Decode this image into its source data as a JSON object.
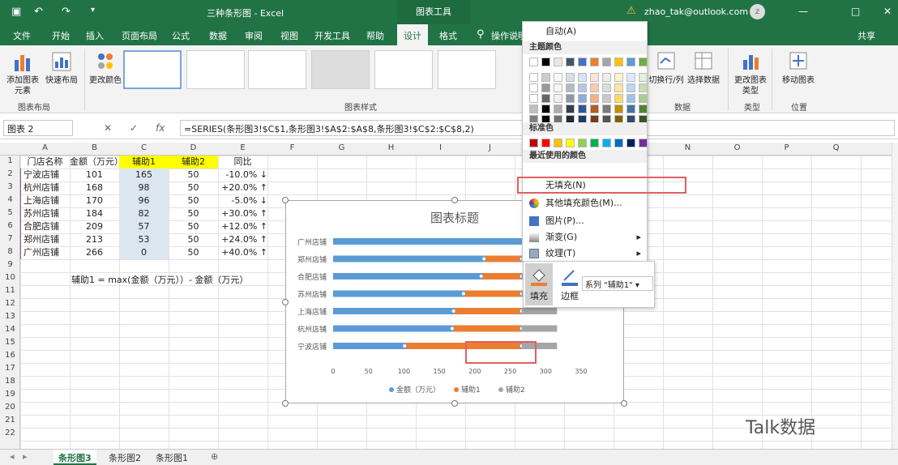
{
  "window": {
    "doc_title": "三种条形图 - Excel",
    "context_tab": "图表工具",
    "user": "zhao_tak@outlook.com",
    "avatar_letter": "z",
    "controls": [
      "—",
      "□",
      "✕"
    ]
  },
  "ribbon_tabs": [
    "文件",
    "开始",
    "插入",
    "页面布局",
    "公式",
    "数据",
    "审阅",
    "视图",
    "开发工具",
    "帮助",
    "设计",
    "格式"
  ],
  "active_tab": "设计",
  "tell_me": "操作说明搜索",
  "share": "共享",
  "ribbon": {
    "add_element": "添加图表元素",
    "quick_layout": "快速布局",
    "change_colors": "更改颜色",
    "group_layouts": "图表布局",
    "group_styles": "图表样式",
    "switch_row_col": "切换行/列",
    "select_data": "选择数据",
    "group_data": "数据",
    "change_type": "更改图表类型",
    "group_type": "类型",
    "move_chart": "移动图表",
    "group_location": "位置"
  },
  "formula_bar": {
    "name_box": "图表 2",
    "formula": "=SERIES(条形图3!$C$1,条形图3!$A$2:$A$8,条形图3!$C$2:$C$8,2)"
  },
  "columns": [
    "A",
    "B",
    "C",
    "D",
    "E",
    "F",
    "G",
    "H",
    "I",
    "J",
    "K",
    "L",
    "M",
    "N",
    "O",
    "P",
    "Q"
  ],
  "rows": [
    "1",
    "2",
    "3",
    "4",
    "5",
    "6",
    "7",
    "8",
    "9",
    "10",
    "11",
    "12",
    "13",
    "14",
    "15",
    "16",
    "17",
    "18",
    "19",
    "20",
    "21",
    "22"
  ],
  "table": {
    "headers": [
      "门店名称",
      "金额（万元）",
      "辅助1",
      "辅助2",
      "同比"
    ],
    "rows": [
      [
        "宁波店铺",
        "101",
        "165",
        "50",
        "-10.0% ↓"
      ],
      [
        "杭州店铺",
        "168",
        "98",
        "50",
        "+20.0% ↑"
      ],
      [
        "上海店铺",
        "170",
        "96",
        "50",
        "-5.0% ↓"
      ],
      [
        "苏州店铺",
        "184",
        "82",
        "50",
        "+30.0% ↑"
      ],
      [
        "合肥店铺",
        "209",
        "57",
        "50",
        "+12.0% ↑"
      ],
      [
        "郑州店铺",
        "213",
        "53",
        "50",
        "+24.0% ↑"
      ],
      [
        "广州店铺",
        "266",
        "0",
        "50",
        "+40.0% ↑"
      ]
    ],
    "note": "辅助1 = max(金额（万元））- 金额（万元）"
  },
  "sheet_tabs": [
    "条形图3",
    "条形图2",
    "条形图1"
  ],
  "active_sheet": "条形图3",
  "colors": {
    "green": "#217346",
    "blue": "#5b9bd5",
    "orange": "#ed7d31",
    "gray": "#a5a5a5",
    "yellow": "#ffff00"
  },
  "chart_data": {
    "type": "bar",
    "title": "图表标题",
    "categories": [
      "广州店铺",
      "郑州店铺",
      "合肥店铺",
      "苏州店铺",
      "上海店铺",
      "杭州店铺",
      "宁波店铺"
    ],
    "series": [
      {
        "name": "金额（万元）",
        "values": [
          266,
          213,
          209,
          184,
          170,
          168,
          101
        ]
      },
      {
        "name": "辅助1",
        "values": [
          0,
          53,
          57,
          82,
          96,
          98,
          165
        ]
      },
      {
        "name": "辅助2",
        "values": [
          50,
          50,
          50,
          50,
          50,
          50,
          50
        ]
      }
    ],
    "xlim": [
      0,
      350
    ],
    "x_ticks": [
      "0",
      "50",
      "100",
      "150",
      "200",
      "250",
      "300",
      "350"
    ],
    "stacked": true,
    "legend": "bottom"
  },
  "color_popup": {
    "auto": "自动(A)",
    "theme_colors": "主题颜色",
    "standard_colors": "标准色",
    "recent_colors": "最近使用的颜色",
    "no_fill": "无填充(N)",
    "more_colors": "其他填充颜色(M)...",
    "picture": "图片(P)...",
    "gradient": "渐变(G)",
    "texture": "纹理(T)",
    "theme_grid": [
      "#ffffff",
      "#000000",
      "#e7e6e6",
      "#44546a",
      "#4472c4",
      "#ed7d31",
      "#a5a5a5",
      "#ffc000",
      "#5b9bd5",
      "#70ad47"
    ],
    "standard_row": [
      "#c00000",
      "#ff0000",
      "#ffc000",
      "#ffff00",
      "#92d050",
      "#00b050",
      "#00b0f0",
      "#0070c0",
      "#002060",
      "#7030a0"
    ]
  },
  "mini_toolbar": {
    "fill": "填充",
    "outline": "边框",
    "series_select": "系列 \"辅助1\""
  },
  "watermark": "Talk数据"
}
